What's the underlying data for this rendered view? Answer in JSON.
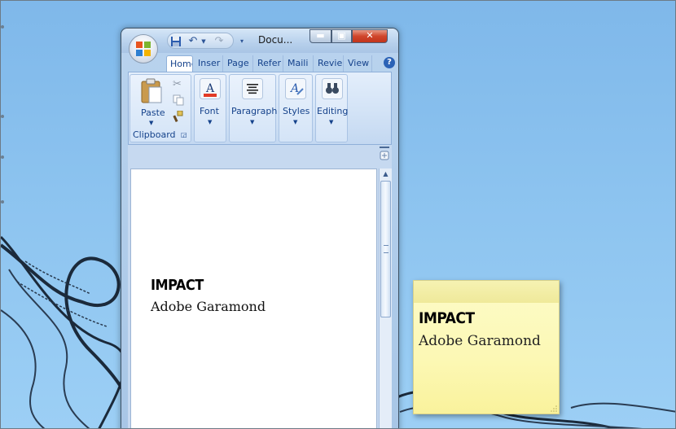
{
  "window": {
    "title": "Docu...",
    "tabs": [
      "Home",
      "Inser",
      "Page",
      "Refer",
      "Maili",
      "Revie",
      "View"
    ],
    "active_tab": "Home"
  },
  "ribbon": {
    "clipboard_group": "Clipboard",
    "paste_label": "Paste",
    "font_label": "Font",
    "paragraph_label": "Paragraph",
    "styles_label": "Styles",
    "editing_label": "Editing"
  },
  "document": {
    "line1": "IMPACT",
    "line2": "Adobe Garamond"
  },
  "sticky_note": {
    "line1": "IMPACT",
    "line2": "Adobe Garamond"
  },
  "colors": {
    "desktop": "#8cc3ef",
    "note": "#fcf8b4",
    "ribbon_text": "#15428b",
    "close_button": "#d0452b"
  },
  "icons": [
    "office-logo-icon",
    "save-icon",
    "undo-icon",
    "redo-icon",
    "customize-qat-icon",
    "minimize-icon",
    "maximize-icon",
    "close-icon",
    "help-icon",
    "paste-icon",
    "cut-icon",
    "copy-icon",
    "format-painter-icon",
    "font-color-icon",
    "align-icon",
    "styles-icon",
    "find-icon",
    "ruler-toggle-icon"
  ]
}
